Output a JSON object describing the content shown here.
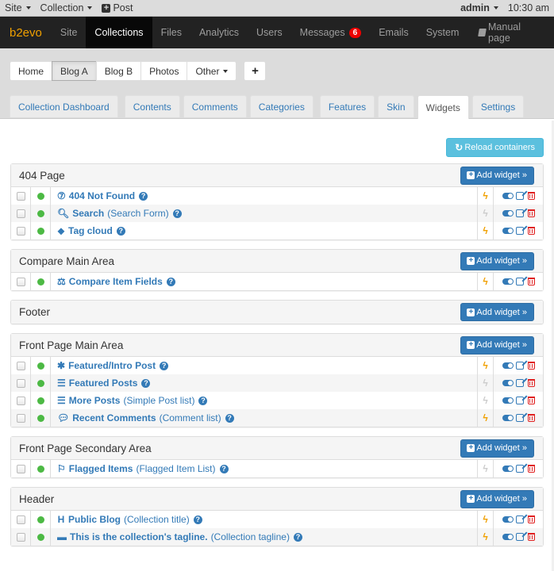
{
  "evobar": {
    "site_label": "Site",
    "collection_label": "Collection",
    "post_label": "Post",
    "user_label": "admin",
    "time": "10:30 am"
  },
  "mainnav": {
    "brand": "b2evo",
    "items": [
      {
        "label": "Site",
        "active": false
      },
      {
        "label": "Collections",
        "active": true
      },
      {
        "label": "Files",
        "active": false
      },
      {
        "label": "Analytics",
        "active": false
      },
      {
        "label": "Users",
        "active": false
      },
      {
        "label": "Messages",
        "active": false,
        "badge": "6"
      },
      {
        "label": "Emails",
        "active": false
      },
      {
        "label": "System",
        "active": false
      }
    ],
    "manual_label": "Manual page"
  },
  "collections": {
    "buttons": [
      {
        "label": "Home",
        "active": false
      },
      {
        "label": "Blog A",
        "active": true
      },
      {
        "label": "Blog B",
        "active": false
      },
      {
        "label": "Photos",
        "active": false
      },
      {
        "label": "Other",
        "active": false
      }
    ],
    "add_label": "+"
  },
  "tabs": [
    {
      "label": "Collection Dashboard",
      "active": false
    },
    {
      "label": "Contents",
      "active": false
    },
    {
      "label": "Comments",
      "active": false
    },
    {
      "label": "Categories",
      "active": false
    },
    {
      "label": "Features",
      "active": false
    },
    {
      "label": "Skin",
      "active": false
    },
    {
      "label": "Widgets",
      "active": true
    },
    {
      "label": "Settings",
      "active": false
    }
  ],
  "reload_label": "Reload containers",
  "add_widget_label": "Add widget »",
  "colors": {
    "link": "#337ab7",
    "enabled_dot": "#4cb944",
    "cache_on": "#f0a000",
    "cache_off": "#cccccc",
    "delete": "#e02020",
    "brand": "#f0a000",
    "reload_button": "#5bc0de"
  },
  "containers": [
    {
      "title": "404 Page",
      "widgets": [
        {
          "icon": "question-circle-icon",
          "glyph": "⑦",
          "name": "404 Not Found",
          "type": "",
          "cache": true
        },
        {
          "icon": "search-icon",
          "glyph": "🔍︎",
          "name": "Search",
          "type": "(Search Form)",
          "cache": false
        },
        {
          "icon": "tags-icon",
          "glyph": "⬥",
          "name": "Tag cloud",
          "type": "",
          "cache": true
        }
      ]
    },
    {
      "title": "Compare Main Area",
      "widgets": [
        {
          "icon": "balance-scale-icon",
          "glyph": "⚖",
          "name": "Compare Item Fields",
          "type": "",
          "cache": true
        }
      ]
    },
    {
      "title": "Footer",
      "widgets": []
    },
    {
      "title": "Front Page Main Area",
      "widgets": [
        {
          "icon": "asterisk-icon",
          "glyph": "✱",
          "name": "Featured/Intro Post",
          "type": "",
          "cache": true
        },
        {
          "icon": "th-list-icon",
          "glyph": "☰",
          "name": "Featured Posts",
          "type": "",
          "cache": false
        },
        {
          "icon": "list-icon",
          "glyph": "☰",
          "name": "More Posts",
          "type": "(Simple Post list)",
          "cache": false
        },
        {
          "icon": "comments-icon",
          "glyph": "💬︎",
          "name": "Recent Comments",
          "type": "(Comment list)",
          "cache": true
        }
      ]
    },
    {
      "title": "Front Page Secondary Area",
      "widgets": [
        {
          "icon": "flag-icon",
          "glyph": "⚐",
          "name": "Flagged Items",
          "type": "(Flagged Item List)",
          "cache": false
        }
      ]
    },
    {
      "title": "Header",
      "widgets": [
        {
          "icon": "header-icon",
          "glyph": "H",
          "name": "Public Blog",
          "type": "(Collection title)",
          "cache": true
        },
        {
          "icon": "minus-icon",
          "glyph": "▬",
          "name": "This is the collection's tagline.",
          "type": "(Collection tagline)",
          "cache": true
        }
      ]
    }
  ]
}
